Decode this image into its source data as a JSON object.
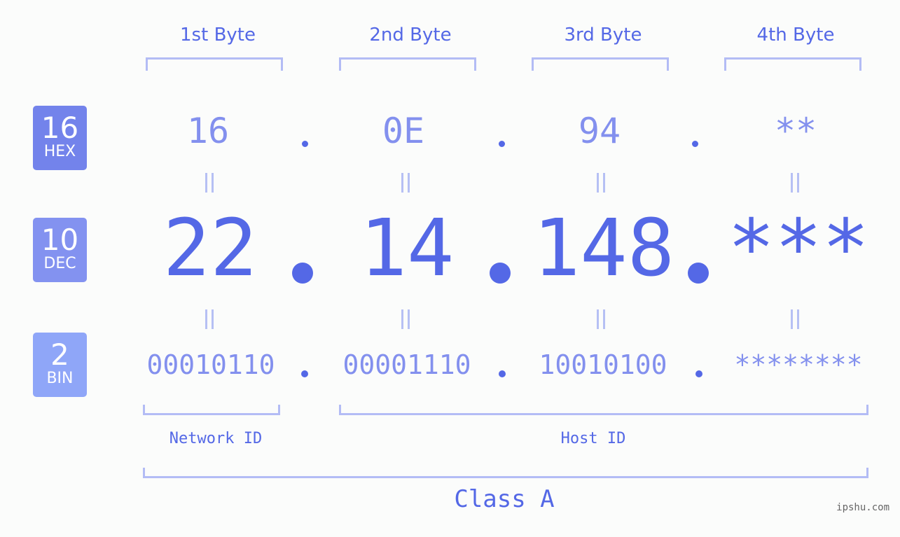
{
  "badges": [
    {
      "number": "16",
      "label": "HEX",
      "color": "#7383eb"
    },
    {
      "number": "10",
      "label": "DEC",
      "color": "#8392f0"
    },
    {
      "number": "2",
      "label": "BIN",
      "color": "#8fa6f8"
    }
  ],
  "byte_headers": [
    "1st Byte",
    "2nd Byte",
    "3rd Byte",
    "4th Byte"
  ],
  "hex": [
    "16",
    "0E",
    "94",
    "**"
  ],
  "dec": [
    "22",
    "14",
    "148",
    "***"
  ],
  "bin": [
    "00010110",
    "00001110",
    "10010100",
    "********"
  ],
  "segments": {
    "network": "Network ID",
    "host": "Host ID"
  },
  "class_label": "Class A",
  "watermark": "ipshu.com",
  "colors": {
    "accent": "#5468e6",
    "light_value": "#8390ee",
    "bracket": "#b3bcf5",
    "background": "#fbfcfb"
  }
}
